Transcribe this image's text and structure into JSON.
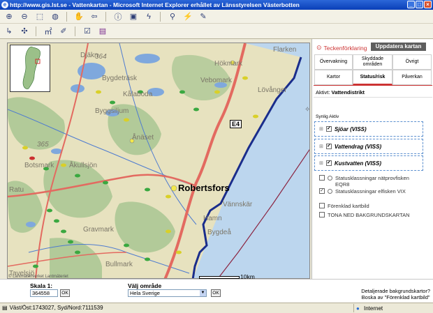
{
  "window": {
    "title": "http://www.gis.lst.se - Vattenkartan - Microsoft Internet Explorer erhållet av Länsstyrelsen Västerbotten"
  },
  "toolbar": {
    "row1_icons": [
      "zoom-in-icon",
      "zoom-out-icon",
      "zoom-box-icon",
      "full-extent-icon",
      "pan-icon",
      "back-icon",
      "identify-icon",
      "print-icon",
      "lightning-icon",
      "find-icon",
      "hyperlink-icon",
      "measure-icon"
    ],
    "row2_icons": [
      "coordinate-icon",
      "xy-coordinate-icon",
      "area-measure-icon",
      "edit-icon",
      "select-icon",
      "book-icon"
    ]
  },
  "map": {
    "places": [
      "Bygdeträsk",
      "Kålaboda",
      "Byggsiljum",
      "Ånäset",
      "Botsmark",
      "Åkullsjön",
      "Robertsfors",
      "Vännskär",
      "Gravmark",
      "Bygdeå",
      "Bullmark",
      "Hökmark",
      "Vebomark",
      "Ovanåker",
      "Lövånger",
      "Fjälläsk",
      "Flarken",
      "Tavelsjö",
      "Hamn",
      "Ratu",
      "Djäkn"
    ],
    "numbers": [
      "364",
      "365"
    ],
    "road_sign": "E4",
    "scale_label": "10km",
    "copyright": "© Lantmäteriverket Lantmäteriet"
  },
  "panel": {
    "legend_link": "Teckenförklaring",
    "update_button": "Uppdatera kartan",
    "tabs_row1": [
      "Övervakning",
      "Skyddade områden",
      "Övrigt"
    ],
    "tabs_row2": [
      "Kartor",
      "Status/risk",
      "Påverkan"
    ],
    "active_label": "Aktivt:",
    "active_value": "Vattendistrikt",
    "synlig_aktiv": "Synlig Aktiv",
    "groups": [
      "Sjöar (VISS)",
      "Vattendrag (VISS)",
      "Kustvatten (VISS)"
    ],
    "options": [
      {
        "label": "Statusklassningar nätprovfisken EQR8",
        "checked": false
      },
      {
        "label": "Statusklassningar elfisken VIX",
        "checked": true
      },
      {
        "label": "Förenklad kartbild",
        "checked": false
      },
      {
        "label": "TONA NED BAKGRUNDSKARTAN",
        "checked": false
      }
    ]
  },
  "bottom": {
    "skala_label": "Skala 1:",
    "skala_value": "364558",
    "ok": "OK",
    "valj_label": "Välj område",
    "valj_value": "Hela Sverige",
    "detalj_line1": "Detaljerade bakgrundskartor?",
    "detalj_line2": "Boska av \"Förenklad kartbild\""
  },
  "status": {
    "coords": "Väst/Öst:1743027, Syd/Nord:7111539",
    "zone": "Internet"
  },
  "colors": {
    "water": "#bcd6ee",
    "land": "#e7e2bf",
    "forest": "#9bc089",
    "road": "#e36a60",
    "coast": "#1a2d8c",
    "accent": "#cc3333"
  }
}
